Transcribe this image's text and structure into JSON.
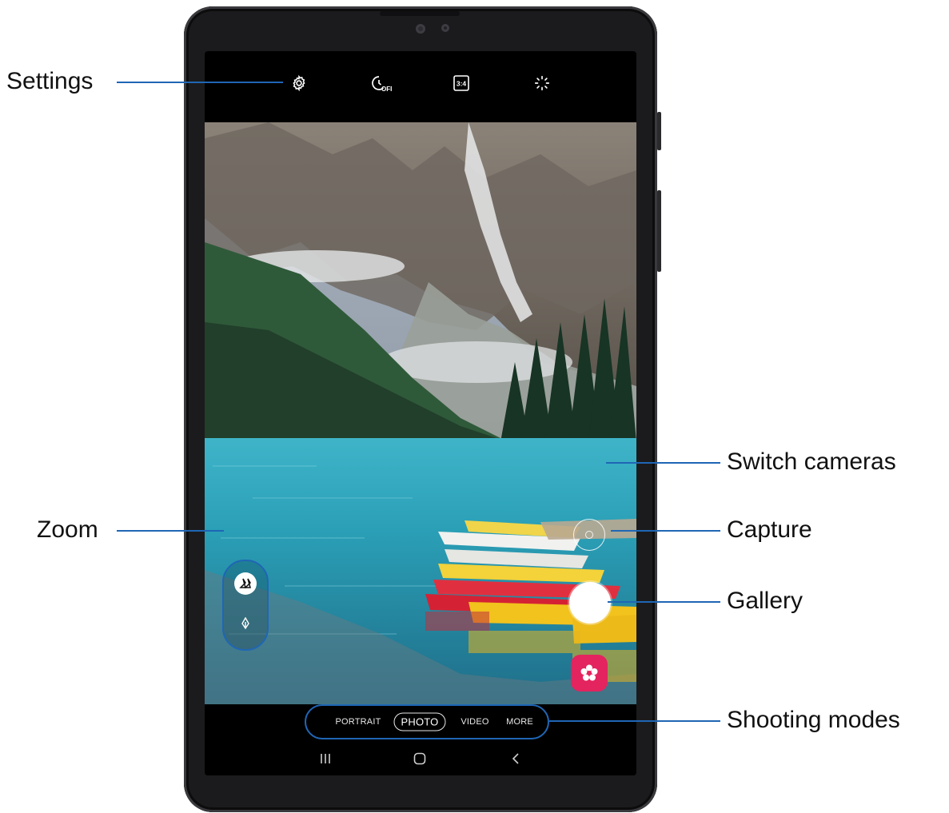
{
  "callouts": {
    "settings": "Settings",
    "zoom": "Zoom",
    "switch_cameras": "Switch cameras",
    "capture": "Capture",
    "gallery": "Gallery",
    "shooting_modes": "Shooting modes"
  },
  "toolbar": {
    "icons": [
      "gear-icon",
      "timer-off-icon",
      "aspect-ratio-icon",
      "filter-effects-icon"
    ],
    "timer_badge": "OFF",
    "aspect_ratio": "3:4"
  },
  "shooting_modes": {
    "items": [
      "PORTRAIT",
      "PHOTO",
      "VIDEO",
      "MORE"
    ],
    "selected": "PHOTO"
  },
  "navigation": {
    "icons": [
      "recent-apps-icon",
      "home-icon",
      "back-icon"
    ]
  },
  "colors": {
    "accent": "#1f66b5",
    "gallery": "#e3245f"
  }
}
